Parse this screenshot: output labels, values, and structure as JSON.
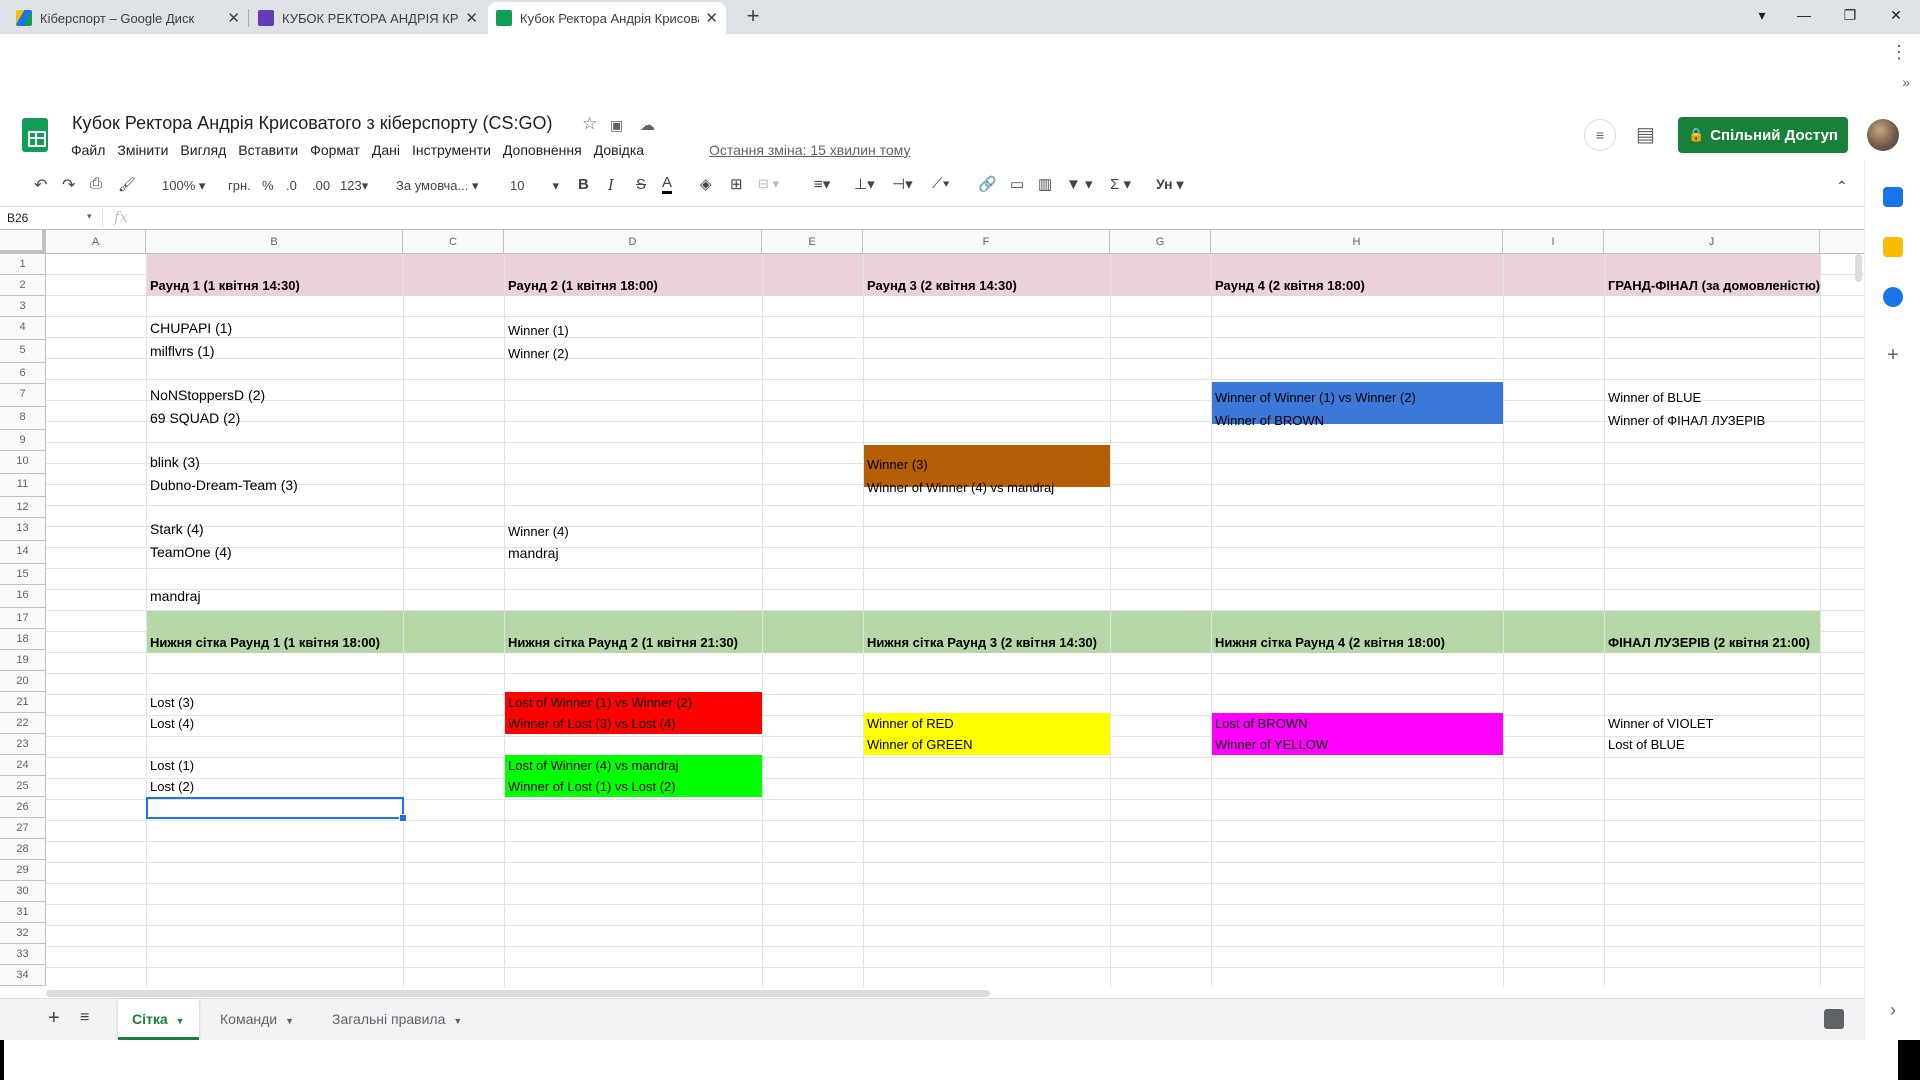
{
  "browser": {
    "tabs": [
      {
        "title": "Кіберспорт – Google Диск",
        "active": false,
        "icon": "google-drive-icon"
      },
      {
        "title": "КУБОК РЕКТОРА АНДРІЯ КРИСОВАТОГО",
        "active": false,
        "icon": "google-forms-icon"
      },
      {
        "title": "Кубок Ректора Андрія Крисоватого з кіберспорту (CS:GO)",
        "active": true,
        "icon": "google-sheets-icon"
      }
    ],
    "new_tab": "+",
    "close": "✕",
    "window_controls": {
      "profile": "▾",
      "minimize": "—",
      "maximize": "❐",
      "close": "✕"
    }
  },
  "app": {
    "title": "Кубок Ректора Андрія Крисоватого з кіберспорту (CS:GO)",
    "menu": [
      "Файл",
      "Змінити",
      "Вигляд",
      "Вставити",
      "Формат",
      "Дані",
      "Інструменти",
      "Доповнення",
      "Довідка"
    ],
    "last_edit": "Остання зміна: 15 хвилин тому",
    "share_label": "Спільний Доступ",
    "colors": {
      "accent": "#188038",
      "selection": "#1a73e8"
    }
  },
  "toolbar": {
    "zoom": "100%",
    "currency": "грн.",
    "percent": "%",
    "dec_less": ".0",
    "dec_more": ".00",
    "format_more": "123",
    "font": "За умовча...",
    "font_size": "10",
    "bold": "B",
    "italic": "I",
    "strike": "S",
    "text_color": "A",
    "input_tools": "Ун"
  },
  "formula_bar": {
    "name_box": "B26",
    "fx": "fx",
    "value": ""
  },
  "sheet": {
    "columns": [
      "A",
      "B",
      "C",
      "D",
      "E",
      "F",
      "G",
      "H",
      "I",
      "J"
    ],
    "rows": [
      "1",
      "2",
      "3",
      "4",
      "5",
      "6",
      "7",
      "8",
      "9",
      "10",
      "11",
      "12",
      "13",
      "14",
      "15",
      "16",
      "17",
      "18",
      "19",
      "20",
      "21",
      "22",
      "23",
      "24",
      "25",
      "26",
      "27",
      "28",
      "29",
      "30",
      "31",
      "32",
      "33",
      "34"
    ],
    "headers_upper": {
      "b": "Раунд 1 (1 квітня 14:30)",
      "d": "Раунд 2 (1 квітня 18:00)",
      "f": "Раунд 3 (2 квітня 14:30)",
      "h": "Раунд 4 (2 квітня 18:00)",
      "j": "ГРАНД-ФІНАЛ (за домовленістю)"
    },
    "headers_lower": {
      "b": "Нижня сітка Раунд 1 (1 квітня 18:00)",
      "d": "Нижня сітка Раунд 2 (1 квітня 21:30)",
      "f": "Нижня сітка Раунд 3 (2 квітня 14:30)",
      "h": "Нижня сітка Раунд 4 (2 квітня 18:00)",
      "j": "ФІНАЛ ЛУЗЕРІВ (2 квітня 21:00)"
    },
    "b": {
      "r4": "CHUPAPI (1)",
      "r5": "milflvrs (1)",
      "r7": "NoNStoppersD (2)",
      "r8": "69 SQUAD (2)",
      "r10": "blink (3)",
      "r11": "Dubno-Dream-Team (3)",
      "r13": "Stark (4)",
      "r14": "TeamOne (4)",
      "r16": "mandraj",
      "r21": "Lost (3)",
      "r22": "Lost (4)",
      "r24": "Lost (1)",
      "r25": "Lost (2)"
    },
    "d": {
      "r4": "Winner (1)",
      "r5": "Winner (2)",
      "r13": "Winner (4)",
      "r14": "mandraj",
      "r21": "Lost of Winner (1) vs Winner (2)",
      "r22": "Winner of Lost (3) vs Lost (4)",
      "r24": "Lost of Winner (4) vs mandraj",
      "r25": "Winner of Lost (1) vs Lost (2)"
    },
    "f": {
      "r10": "Winner (3)",
      "r11": "Winner of Winner (4) vs mandraj",
      "r22": "Winner of RED",
      "r23": "Winner of GREEN"
    },
    "h": {
      "r7": "Winner of Winner (1) vs Winner (2)",
      "r8": "Winner of BROWN",
      "r22": "Lost of BROWN",
      "r23": "Winner of YELLOW"
    },
    "j": {
      "r7": "Winner of BLUE",
      "r8": "Winner of ФІНАЛ ЛУЗЕРІВ",
      "r22": "Winner of VIOLET",
      "r23": "Lost of BLUE"
    },
    "fills": {
      "pink": "#ead1dc",
      "green_band": "#b6d7a8",
      "blue": "#3c78d8",
      "brown": "#b45f06",
      "red": "#ff0000",
      "lime": "#00ff00",
      "yellow": "#ffff00",
      "magenta": "#ff00ff"
    }
  },
  "sheet_tabs": [
    {
      "label": "Сітка",
      "active": true
    },
    {
      "label": "Команди",
      "active": false
    },
    {
      "label": "Загальні правила",
      "active": false
    }
  ]
}
